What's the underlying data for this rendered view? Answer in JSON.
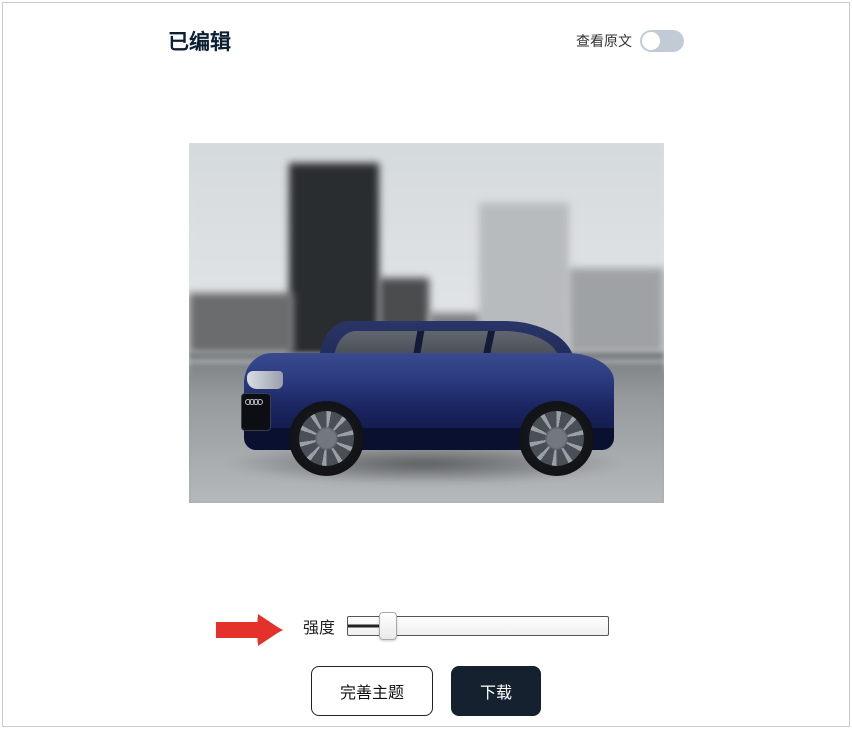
{
  "header": {
    "title": "已编辑",
    "toggle_label": "查看原文",
    "toggle_state": "off"
  },
  "slider": {
    "label": "强度",
    "value_percent": 17
  },
  "buttons": {
    "refine": "完善主题",
    "download": "下载"
  },
  "annotation": {
    "arrow_color": "#e4312b"
  }
}
